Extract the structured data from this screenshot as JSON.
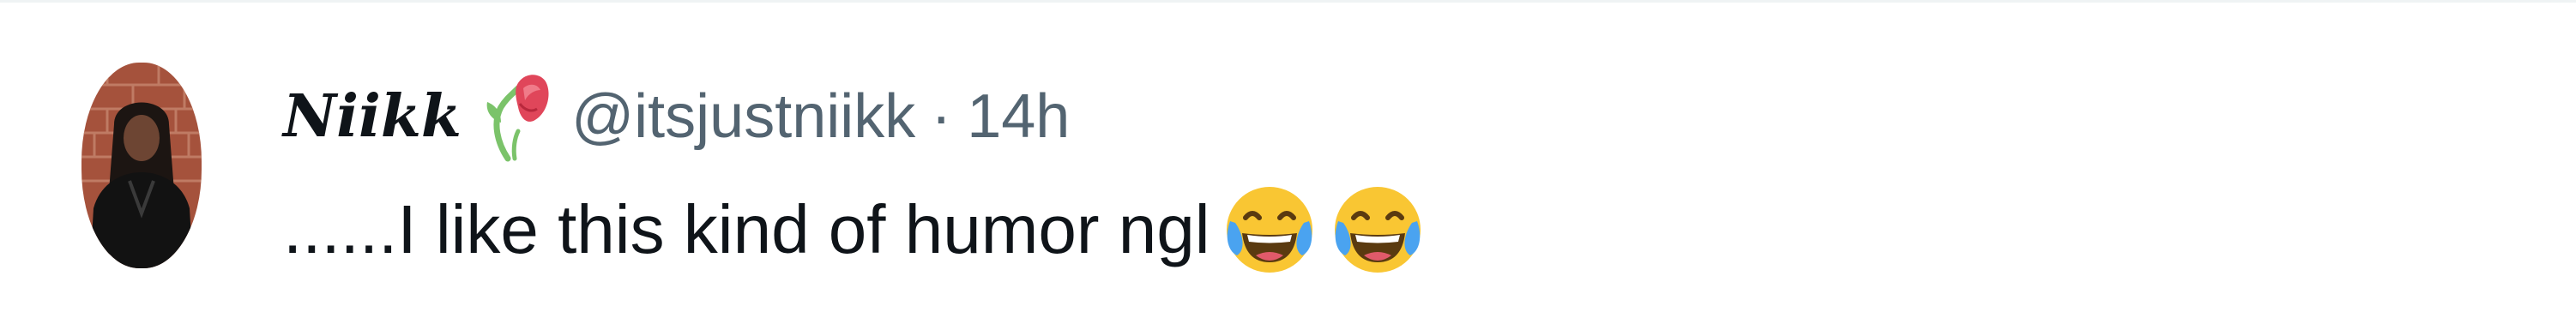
{
  "tweet": {
    "author": {
      "display_name": "Niikk",
      "name_emoji": "wilted-rose-icon",
      "handle": "@itsjustniikk"
    },
    "separator": "·",
    "timestamp": "14h",
    "text": "......I like this kind of humor ngl",
    "emojis": [
      "face-with-tears-of-joy-icon",
      "face-with-tears-of-joy-icon"
    ]
  },
  "colors": {
    "primary_text": "#0f1419",
    "secondary_text": "#536471",
    "divider": "#eff3f4",
    "emoji_yellow": "#f9c633",
    "tear_blue": "#4aa3f0",
    "rose_red": "#e0465a",
    "stem_green": "#7bc36a"
  }
}
